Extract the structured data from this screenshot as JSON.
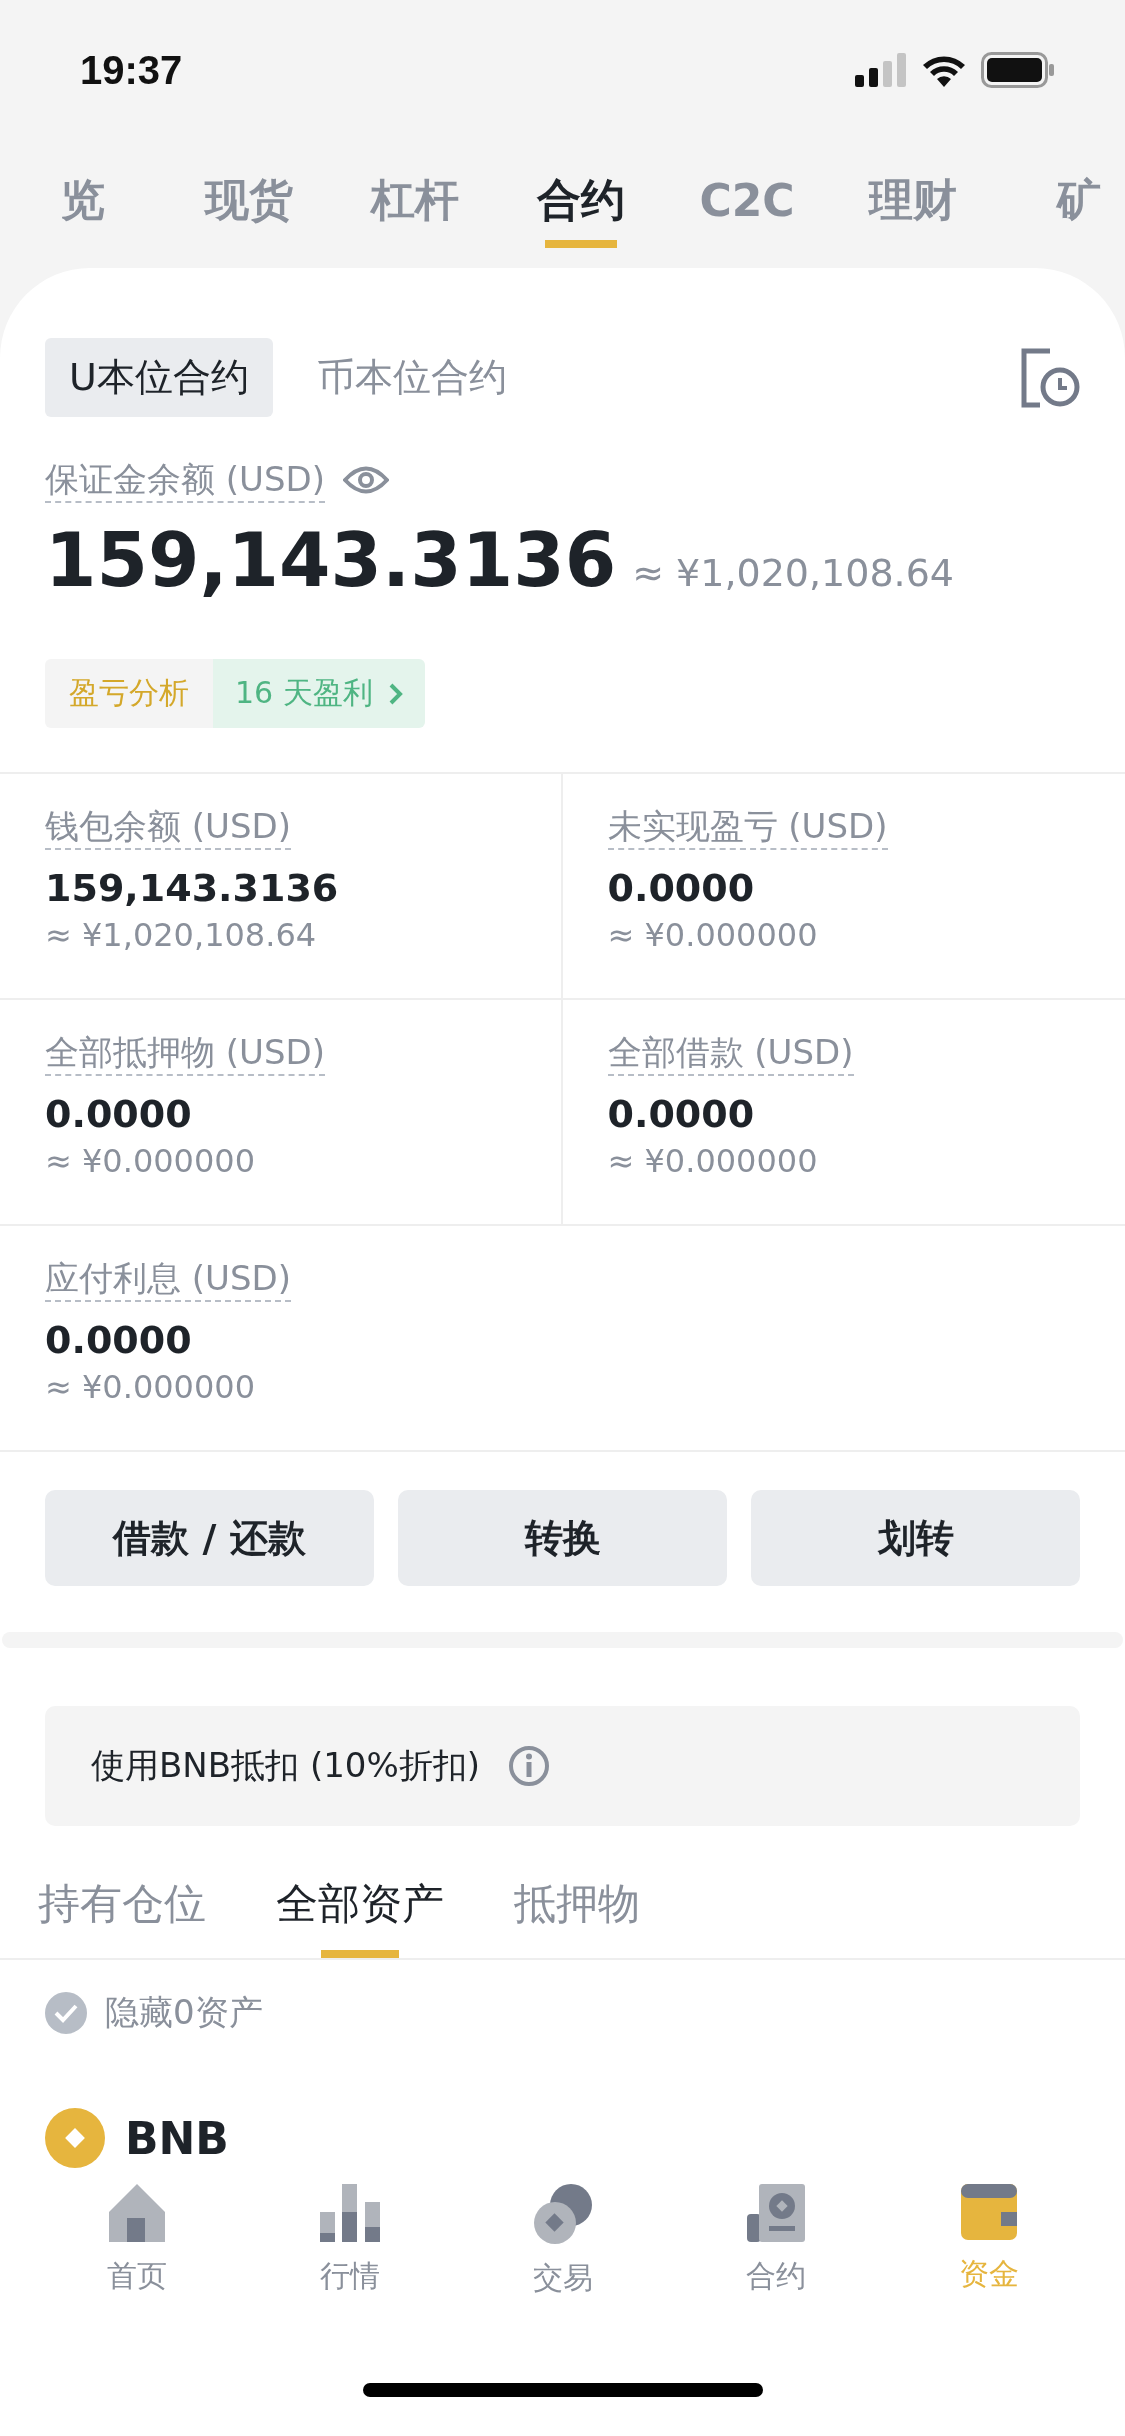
{
  "status_bar": {
    "time": "19:37"
  },
  "top_tabs": [
    {
      "label": "览",
      "selected": false
    },
    {
      "label": "现货",
      "selected": false
    },
    {
      "label": "杠杆",
      "selected": false
    },
    {
      "label": "合约",
      "selected": true
    },
    {
      "label": "C2C",
      "selected": false
    },
    {
      "label": "理财",
      "selected": false
    },
    {
      "label": "矿",
      "selected": false
    }
  ],
  "contract_tabs": [
    {
      "label": "U本位合约",
      "selected": true
    },
    {
      "label": "币本位合约",
      "selected": false
    }
  ],
  "margin_balance": {
    "label": "保证金余额 (USD)",
    "value": "159,143.3136",
    "approx": "≈ ¥1,020,108.64"
  },
  "pnl": {
    "analysis": "盈亏分析",
    "streak": "16 天盈利"
  },
  "stats": [
    {
      "label": "钱包余额 (USD)",
      "value": "159,143.3136",
      "approx": "≈ ¥1,020,108.64"
    },
    {
      "label": "未实现盈亏 (USD)",
      "value": "0.0000",
      "approx": "≈ ¥0.000000"
    },
    {
      "label": "全部抵押物 (USD)",
      "value": "0.0000",
      "approx": "≈ ¥0.000000"
    },
    {
      "label": "全部借款 (USD)",
      "value": "0.0000",
      "approx": "≈ ¥0.000000"
    },
    {
      "label": "应付利息 (USD)",
      "value": "0.0000",
      "approx": "≈ ¥0.000000"
    }
  ],
  "actions": [
    "借款 / 还款",
    "转换",
    "划转"
  ],
  "bnb_deduction": {
    "label": "使用BNB抵扣 (10%折扣)"
  },
  "asset_tabs": [
    {
      "label": "持有仓位",
      "selected": false
    },
    {
      "label": "全部资产",
      "selected": true
    },
    {
      "label": "抵押物",
      "selected": false
    }
  ],
  "hide_zero": {
    "label": "隐藏0资产",
    "checked": true
  },
  "assets": [
    {
      "name": "BNB"
    }
  ],
  "bottom_nav": [
    {
      "kind": "home",
      "label": "首页",
      "selected": false
    },
    {
      "kind": "markets",
      "label": "行情",
      "selected": false
    },
    {
      "kind": "trade",
      "label": "交易",
      "selected": false
    },
    {
      "kind": "futures",
      "label": "合约",
      "selected": false
    },
    {
      "kind": "wallet",
      "label": "资金",
      "selected": true
    }
  ]
}
